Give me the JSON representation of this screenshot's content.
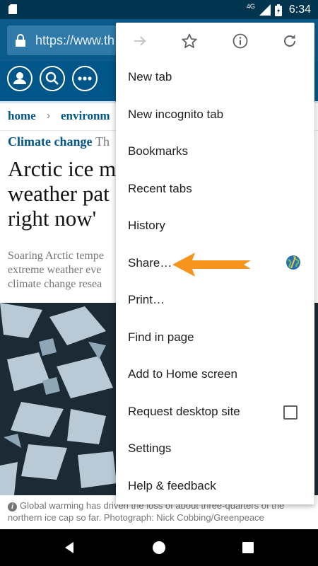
{
  "status_bar": {
    "time": "6:34",
    "network": "4G",
    "icons": [
      "sd-card-icon",
      "signal-icon",
      "battery-icon"
    ]
  },
  "browser": {
    "url": "https://www.th",
    "menu_icons": [
      "forward-arrow-icon",
      "star-icon",
      "info-icon",
      "reload-icon"
    ],
    "menu_items": [
      {
        "label": "New tab"
      },
      {
        "label": "New incognito tab"
      },
      {
        "label": "Bookmarks"
      },
      {
        "label": "Recent tabs"
      },
      {
        "label": "History"
      },
      {
        "label": "Share…"
      },
      {
        "label": "Print…"
      },
      {
        "label": "Find in page"
      },
      {
        "label": "Add to Home screen"
      },
      {
        "label": "Request desktop site"
      },
      {
        "label": "Settings"
      },
      {
        "label": "Help & feedback"
      }
    ],
    "request_desktop_checked": false
  },
  "article": {
    "breadcrumbs": [
      "home",
      "environm"
    ],
    "kicker": "Climate change",
    "kicker_rest": "Th",
    "headline_lines": [
      "Arctic ice m",
      "weather pat",
      "right now'"
    ],
    "standfirst_lines": [
      "Soaring Arctic tempe",
      "extreme weather eve",
      "climate change resea"
    ],
    "caption": "Global warming has driven the loss of about three-quarters of the northern ice cap so far. Photograph: Nick Cobbing/Greenpeace"
  },
  "colors": {
    "status_bar": "#00344f",
    "toolbar": "#0a5a8c",
    "guardian_header": "#005689",
    "annotation_arrow": "#f7941d"
  }
}
